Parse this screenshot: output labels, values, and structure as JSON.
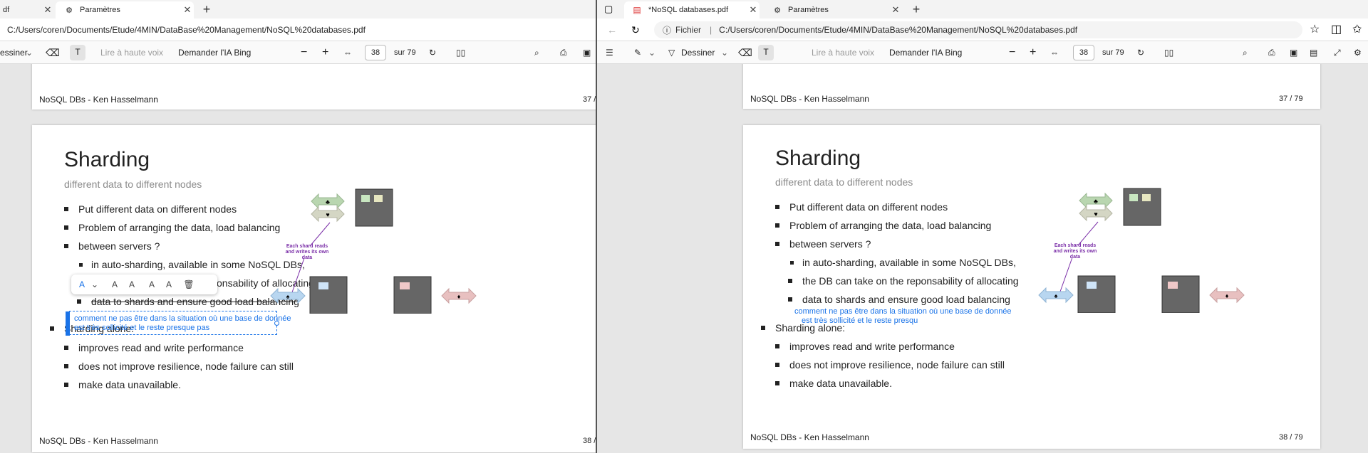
{
  "left": {
    "tabs": [
      {
        "label": "df"
      },
      {
        "label": "Paramètres"
      }
    ],
    "url": "C:/Users/coren/Documents/Etude/4MIN/DataBase%20Management/NoSQL%20databases.pdf",
    "toolbar": {
      "draw": "essiner",
      "read_aloud": "Lire à haute voix",
      "ask_bing": "Demander l'IA Bing",
      "page": "38",
      "page_total": "sur 79"
    },
    "prev_page": {
      "footer": "NoSQL DBs - Ken Hasselmann",
      "num": "37 /"
    },
    "page": {
      "title": "Sharding",
      "subtitle": "different data to different nodes",
      "b1": "Put different data on different nodes",
      "b2a": "Problem of arranging the data, load balancing",
      "b2b": "between servers ?",
      "b3a": "in auto-sharding, available in some NoSQL DBs,",
      "b3b": "onsability of allocating",
      "b3c": "data to shards and ensure good load balancing",
      "alone": "Sharding alone:",
      "b4": "improves read and write performance",
      "b5a": "does not improve resilience, node failure can still",
      "b5b": "make data unavailable.",
      "annotation_1": "comment ne pas être dans la situation où une base de donnée",
      "annotation_2": "est très sollicité et le reste presque pas",
      "diagram_label": "Each shard reads and writes its own data",
      "footer": "NoSQL DBs - Ken Hasselmann",
      "num": "38 /"
    }
  },
  "right": {
    "tabs": [
      {
        "label": "*NoSQL databases.pdf"
      },
      {
        "label": "Paramètres"
      }
    ],
    "url_prefix": "Fichier",
    "url": "C:/Users/coren/Documents/Etude/4MIN/DataBase%20Management/NoSQL%20databases.pdf",
    "toolbar": {
      "draw": "Dessiner",
      "read_aloud": "Lire à haute voix",
      "ask_bing": "Demander l'IA Bing",
      "page": "38",
      "page_total": "sur 79"
    },
    "prev_page": {
      "footer": "NoSQL DBs - Ken Hasselmann",
      "num": "37 / 79"
    },
    "page": {
      "title": "Sharding",
      "subtitle": "different data to different nodes",
      "b1": "Put different data on different nodes",
      "b2a": "Problem of arranging the data, load balancing",
      "b2b": "between servers ?",
      "b3a": "in auto-sharding, available in some NoSQL DBs,",
      "b3b": "the DB can take on the reponsability of allocating",
      "b3c": "data to shards and ensure good load balancing",
      "alone": "Sharding alone:",
      "b4": "improves read and write performance",
      "b5a": "does not improve resilience, node failure can still",
      "b5b": "make data unavailable.",
      "annotation_1": "comment ne pas être dans la situation où une base de donnée",
      "annotation_2": "est très sollicité et le reste presqu",
      "diagram_label": "Each shard reads and writes its own data",
      "footer": "NoSQL DBs - Ken Hasselmann",
      "num": "38 / 79"
    }
  }
}
